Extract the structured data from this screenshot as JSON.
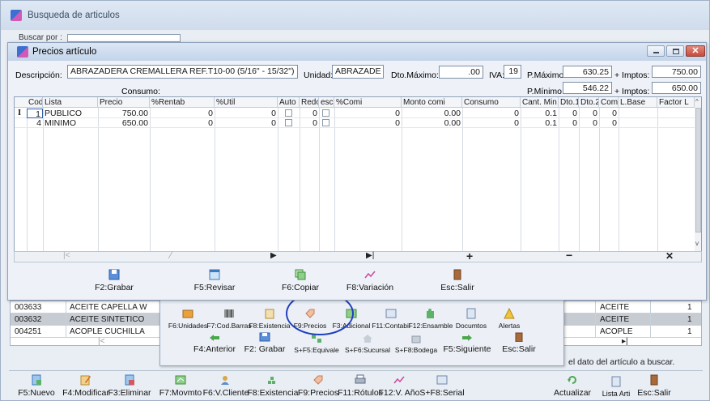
{
  "outer": {
    "title": "Busqueda de articulos",
    "buscar_label": "Buscar por :",
    "rows": [
      {
        "code": "003633",
        "name": "ACEITE CAPELLA W",
        "group": "ACEITE",
        "qty": "1"
      },
      {
        "code": "003632",
        "name": "ACEITE SINTETICO",
        "group": "ACEITE",
        "qty": "1"
      },
      {
        "code": "004251",
        "name": "ACOPLE CUCHILLA",
        "group": "ACOPLE",
        "qty": "1"
      }
    ],
    "status_text": "el dato del artículo a buscar.",
    "bottom_toolbar": [
      "F5:Nuevo",
      "F4:Modificar",
      "F3:Eliminar",
      "F7:Movmto",
      "F6:V.Cliente",
      "F8:Existencia",
      "F9:Precios",
      "F11:Rótulos",
      "F12:V. Año",
      "S+F8:Serial",
      "Actualizar",
      "Lista Arti",
      "Esc:Salir"
    ]
  },
  "precios": {
    "title": "Precios artículo",
    "descripcion_label": "Descripción:",
    "descripcion_value": "ABRAZADERA CREMALLERA REF.T10-00 (5/16\" - 15/32\")",
    "unidad_label": "Unidad:",
    "unidad_value": "ABRAZADE",
    "dto_label": "Dto.Máximo:",
    "dto_value": ".00",
    "iva_label": "IVA:",
    "iva_value": "19",
    "pmax_label": "P.Máximo:",
    "pmax_value": "630.25",
    "pmax_imp_label": "+ Imptos:",
    "pmax_imp_value": "750.00",
    "pmin_label": "P.Mínimo:",
    "pmin_value": "546.22",
    "pmin_imp_label": "+ Imptos:",
    "pmin_imp_value": "650.00",
    "consumo_label": "Consumo:",
    "columns": [
      "Cod",
      "Lista",
      "Precio",
      "%Rentab",
      "%Util",
      "Auto",
      "Redo",
      "esca",
      "%Comi",
      "Monto comi",
      "Consumo",
      "Cant. Min",
      "Dto.1",
      "Dto.2",
      "Com.I",
      "L.Base",
      "Factor L"
    ],
    "rows": [
      {
        "cod": "1",
        "lista": "PUBLICO",
        "precio": "750.00",
        "rentab": "0",
        "util": "0",
        "redo": "0",
        "comi": "0",
        "monto": "0.00",
        "consumo": "0",
        "cant": "0.1",
        "dto1": "0",
        "dto2": "0",
        "com": "0"
      },
      {
        "cod": "4",
        "lista": "MINIMO",
        "precio": "650.00",
        "rentab": "0",
        "util": "0",
        "redo": "0",
        "comi": "0",
        "monto": "0.00",
        "consumo": "0",
        "cant": "0.1",
        "dto1": "0",
        "dto2": "0",
        "com": "0"
      }
    ],
    "row_marker": "I",
    "toolbar": [
      "F2:Grabar",
      "F5:Revisar",
      "F6:Copiar",
      "F8:Variación",
      "Esc:Salir"
    ]
  },
  "popup": {
    "row1": [
      "F6:Unidades",
      "F7:Cod.Barras",
      "F8:Existencia",
      "F9:Precios",
      "F3:Adicional",
      "F11:Contabil",
      "F12:Ensamble",
      "Documtos",
      "Alertas"
    ],
    "row2": [
      "F4:Anterior",
      "F2: Grabar",
      "S+F5:Equivale",
      "S+F6:Sucursal",
      "S+F8:Bodega",
      "F5:Siguiente",
      "Esc:Salir"
    ]
  },
  "colors": {
    "accent": "#1e3fbf",
    "title_grad_top": "#dbe7f6",
    "title_grad_bottom": "#c2d4ec",
    "close_red": "#c94a3a"
  }
}
